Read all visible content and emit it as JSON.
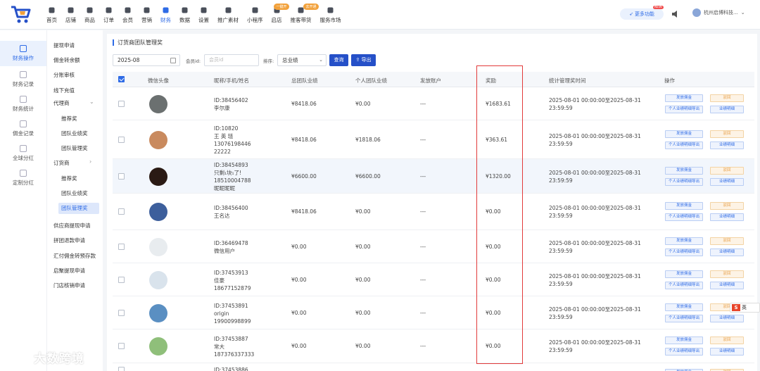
{
  "nav": {
    "items": [
      {
        "label": "首页",
        "icon": "home-icon"
      },
      {
        "label": "店铺",
        "icon": "store-icon"
      },
      {
        "label": "商品",
        "icon": "product-icon"
      },
      {
        "label": "订单",
        "icon": "order-icon"
      },
      {
        "label": "会员",
        "icon": "member-icon"
      },
      {
        "label": "营销",
        "icon": "marketing-icon"
      },
      {
        "label": "财务",
        "icon": "finance-icon"
      },
      {
        "label": "数据",
        "icon": "data-icon"
      },
      {
        "label": "设置",
        "icon": "settings-icon"
      },
      {
        "label": "推广素材",
        "icon": "share-icon"
      },
      {
        "label": "小程序",
        "icon": "miniprogram-icon"
      },
      {
        "label": "启店",
        "icon": "open-store-icon",
        "badge": "一键开"
      },
      {
        "label": "推客带货",
        "icon": "promoter-icon",
        "badge": "去开通"
      },
      {
        "label": "服务市场",
        "icon": "service-market-icon"
      }
    ],
    "active_label": "财务",
    "feature_button": "更多功能",
    "feature_badge": "NEW",
    "user_name": "杭州启博科技..."
  },
  "side1": {
    "items": [
      "财务操作",
      "财务记录",
      "财务统计",
      "佣金记录",
      "全球分红",
      "定制分红"
    ],
    "active": "财务操作"
  },
  "side2": {
    "items": [
      "提现申请",
      "佣金转余额",
      "分账审核",
      "线下充值",
      "代理商",
      "推荐奖",
      "团队业绩奖",
      "团队管理奖",
      "订货商",
      "推荐奖",
      "团队业绩奖",
      "团队管理奖",
      "供应商提现申请",
      "拼团退款申请",
      "汇付佣金转预存款",
      "启聚提现申请",
      "门店核销申请"
    ],
    "active": "团队管理奖"
  },
  "page": {
    "title": "订货商团队管理奖",
    "date_value": "2025-08",
    "member_label": "会员id:",
    "member_placeholder": "会员id",
    "sort_label": "排序:",
    "sort_value": "总业绩",
    "query_btn": "查询",
    "export_btn": "导出"
  },
  "table": {
    "headers": [
      "微信头像",
      "昵称/手机/姓名",
      "总团队业绩",
      "个人团队业绩",
      "发放账户",
      "奖励",
      "统计管理奖时间",
      "操作"
    ],
    "rows": [
      {
        "lines": [
          "ID:38456402",
          "李尔康"
        ],
        "total": "¥8418.06",
        "personal": "¥0.00",
        "account": "---",
        "reward": "¥1683.61",
        "time": [
          "2025-08-01 00:00:00至2025-08-31",
          "23:59:59"
        ],
        "avatar": "#6b7070"
      },
      {
        "lines": [
          "ID:10820",
          "王 英 琏",
          "13076198446",
          "22222"
        ],
        "total": "¥8418.06",
        "personal": "¥1818.06",
        "account": "---",
        "reward": "¥363.61",
        "time": [
          "2025-08-01 00:00:00至2025-08-31",
          "23:59:59"
        ],
        "avatar": "#c98a5e"
      },
      {
        "lines": [
          "ID:38454893",
          "只剩₁块₁了!",
          "18510004788",
          "昵昵昵昵"
        ],
        "total": "¥6600.00",
        "personal": "¥6600.00",
        "account": "---",
        "reward": "¥1320.00",
        "time": [
          "2025-08-01 00:00:00至2025-08-31",
          "23:59:59"
        ],
        "avatar": "#2a1a14"
      },
      {
        "lines": [
          "ID:38456400",
          "王名达"
        ],
        "total": "¥8418.06",
        "personal": "¥0.00",
        "account": "---",
        "reward": "¥0.00",
        "time": [
          "2025-08-01 00:00:00至2025-08-31",
          "23:59:59"
        ],
        "avatar": "#3d5f9c"
      },
      {
        "lines": [
          "ID:36469478",
          "微信用户"
        ],
        "total": "¥0.00",
        "personal": "¥0.00",
        "account": "---",
        "reward": "¥0.00",
        "time": [
          "2025-08-01 00:00:00至2025-08-31",
          "23:59:59"
        ],
        "avatar": "#e8ecef"
      },
      {
        "lines": [
          "ID:37453913",
          "佳豪",
          "18677152879"
        ],
        "total": "¥0.00",
        "personal": "¥0.00",
        "account": "---",
        "reward": "¥0.00",
        "time": [
          "2025-08-01 00:00:00至2025-08-31",
          "23:59:59"
        ],
        "avatar": "#d9e3ec"
      },
      {
        "lines": [
          "ID:37453891",
          "origin",
          "19900998899"
        ],
        "total": "¥0.00",
        "personal": "¥0.00",
        "account": "---",
        "reward": "¥0.00",
        "time": [
          "2025-08-01 00:00:00至2025-08-31",
          "23:59:59"
        ],
        "avatar": "#5a8fc2"
      },
      {
        "lines": [
          "ID:37453887",
          "常大",
          "187376337333"
        ],
        "total": "¥0.00",
        "personal": "¥0.00",
        "account": "---",
        "reward": "¥0.00",
        "time": [
          "2025-08-01 00:00:00至2025-08-31",
          "23:59:59"
        ],
        "avatar": "#8fbf7a"
      },
      {
        "lines": [
          "ID:37453886"
        ],
        "total": "",
        "personal": "",
        "account": "",
        "reward": "",
        "time": [
          "",
          ""
        ],
        "avatar": "#ffffff"
      }
    ],
    "op_labels": {
      "grant": "发放佣金",
      "reject": "驳回",
      "export": "个人业绩明细导出",
      "detail": "业绩明细"
    }
  },
  "watermark": "大数跨境",
  "ime": {
    "logo": "S",
    "label": "英"
  },
  "colors": {
    "accent": "#2e6be6",
    "highlight_box": "#e23a3a"
  }
}
